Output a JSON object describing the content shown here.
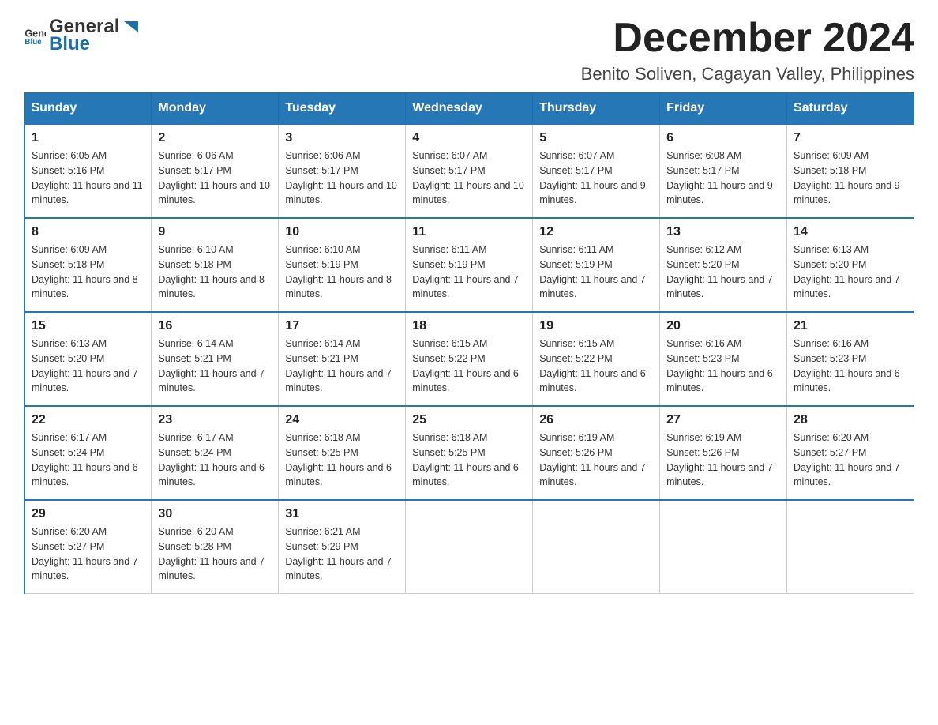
{
  "logo": {
    "text_general": "General",
    "text_blue": "Blue"
  },
  "header": {
    "month_title": "December 2024",
    "location": "Benito Soliven, Cagayan Valley, Philippines"
  },
  "weekdays": [
    "Sunday",
    "Monday",
    "Tuesday",
    "Wednesday",
    "Thursday",
    "Friday",
    "Saturday"
  ],
  "weeks": [
    [
      {
        "day": "1",
        "sunrise": "6:05 AM",
        "sunset": "5:16 PM",
        "daylight": "11 hours and 11 minutes."
      },
      {
        "day": "2",
        "sunrise": "6:06 AM",
        "sunset": "5:17 PM",
        "daylight": "11 hours and 10 minutes."
      },
      {
        "day": "3",
        "sunrise": "6:06 AM",
        "sunset": "5:17 PM",
        "daylight": "11 hours and 10 minutes."
      },
      {
        "day": "4",
        "sunrise": "6:07 AM",
        "sunset": "5:17 PM",
        "daylight": "11 hours and 10 minutes."
      },
      {
        "day": "5",
        "sunrise": "6:07 AM",
        "sunset": "5:17 PM",
        "daylight": "11 hours and 9 minutes."
      },
      {
        "day": "6",
        "sunrise": "6:08 AM",
        "sunset": "5:17 PM",
        "daylight": "11 hours and 9 minutes."
      },
      {
        "day": "7",
        "sunrise": "6:09 AM",
        "sunset": "5:18 PM",
        "daylight": "11 hours and 9 minutes."
      }
    ],
    [
      {
        "day": "8",
        "sunrise": "6:09 AM",
        "sunset": "5:18 PM",
        "daylight": "11 hours and 8 minutes."
      },
      {
        "day": "9",
        "sunrise": "6:10 AM",
        "sunset": "5:18 PM",
        "daylight": "11 hours and 8 minutes."
      },
      {
        "day": "10",
        "sunrise": "6:10 AM",
        "sunset": "5:19 PM",
        "daylight": "11 hours and 8 minutes."
      },
      {
        "day": "11",
        "sunrise": "6:11 AM",
        "sunset": "5:19 PM",
        "daylight": "11 hours and 7 minutes."
      },
      {
        "day": "12",
        "sunrise": "6:11 AM",
        "sunset": "5:19 PM",
        "daylight": "11 hours and 7 minutes."
      },
      {
        "day": "13",
        "sunrise": "6:12 AM",
        "sunset": "5:20 PM",
        "daylight": "11 hours and 7 minutes."
      },
      {
        "day": "14",
        "sunrise": "6:13 AM",
        "sunset": "5:20 PM",
        "daylight": "11 hours and 7 minutes."
      }
    ],
    [
      {
        "day": "15",
        "sunrise": "6:13 AM",
        "sunset": "5:20 PM",
        "daylight": "11 hours and 7 minutes."
      },
      {
        "day": "16",
        "sunrise": "6:14 AM",
        "sunset": "5:21 PM",
        "daylight": "11 hours and 7 minutes."
      },
      {
        "day": "17",
        "sunrise": "6:14 AM",
        "sunset": "5:21 PM",
        "daylight": "11 hours and 7 minutes."
      },
      {
        "day": "18",
        "sunrise": "6:15 AM",
        "sunset": "5:22 PM",
        "daylight": "11 hours and 6 minutes."
      },
      {
        "day": "19",
        "sunrise": "6:15 AM",
        "sunset": "5:22 PM",
        "daylight": "11 hours and 6 minutes."
      },
      {
        "day": "20",
        "sunrise": "6:16 AM",
        "sunset": "5:23 PM",
        "daylight": "11 hours and 6 minutes."
      },
      {
        "day": "21",
        "sunrise": "6:16 AM",
        "sunset": "5:23 PM",
        "daylight": "11 hours and 6 minutes."
      }
    ],
    [
      {
        "day": "22",
        "sunrise": "6:17 AM",
        "sunset": "5:24 PM",
        "daylight": "11 hours and 6 minutes."
      },
      {
        "day": "23",
        "sunrise": "6:17 AM",
        "sunset": "5:24 PM",
        "daylight": "11 hours and 6 minutes."
      },
      {
        "day": "24",
        "sunrise": "6:18 AM",
        "sunset": "5:25 PM",
        "daylight": "11 hours and 6 minutes."
      },
      {
        "day": "25",
        "sunrise": "6:18 AM",
        "sunset": "5:25 PM",
        "daylight": "11 hours and 6 minutes."
      },
      {
        "day": "26",
        "sunrise": "6:19 AM",
        "sunset": "5:26 PM",
        "daylight": "11 hours and 7 minutes."
      },
      {
        "day": "27",
        "sunrise": "6:19 AM",
        "sunset": "5:26 PM",
        "daylight": "11 hours and 7 minutes."
      },
      {
        "day": "28",
        "sunrise": "6:20 AM",
        "sunset": "5:27 PM",
        "daylight": "11 hours and 7 minutes."
      }
    ],
    [
      {
        "day": "29",
        "sunrise": "6:20 AM",
        "sunset": "5:27 PM",
        "daylight": "11 hours and 7 minutes."
      },
      {
        "day": "30",
        "sunrise": "6:20 AM",
        "sunset": "5:28 PM",
        "daylight": "11 hours and 7 minutes."
      },
      {
        "day": "31",
        "sunrise": "6:21 AM",
        "sunset": "5:29 PM",
        "daylight": "11 hours and 7 minutes."
      },
      null,
      null,
      null,
      null
    ]
  ]
}
